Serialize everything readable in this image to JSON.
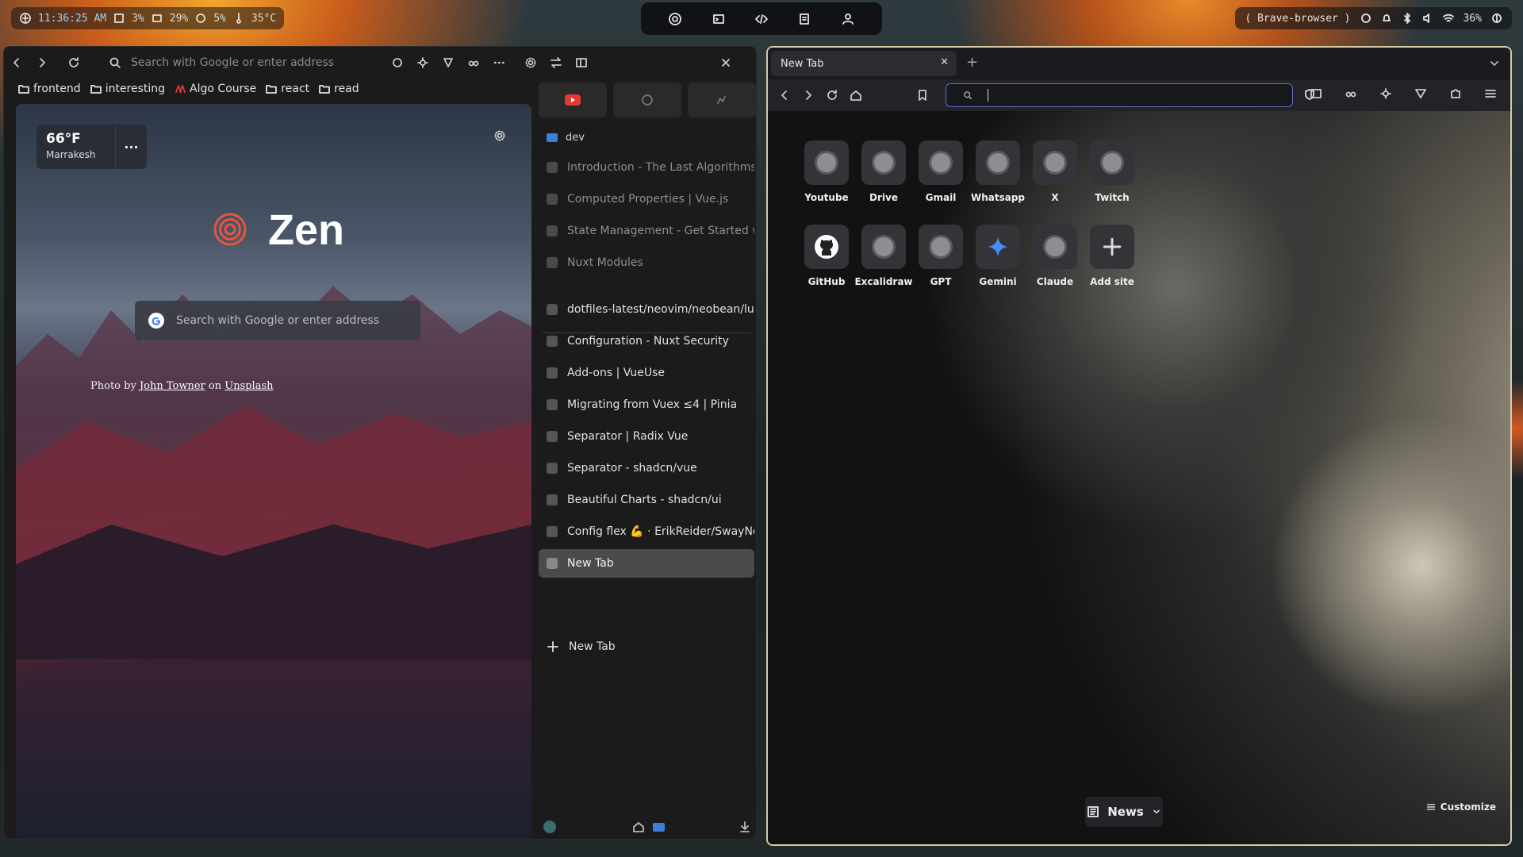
{
  "topbar": {
    "clock": "11:36:25 AM",
    "stats": [
      "3%",
      "29%",
      "5%",
      "35°C"
    ],
    "window_title": "( Brave-browser )",
    "battery": "36%"
  },
  "zen": {
    "address_placeholder": "Search with Google or enter address",
    "bookmarks": [
      "frontend",
      "interesting",
      "Algo Course",
      "react",
      "read"
    ],
    "weather": {
      "temp": "66°F",
      "city": "Marrakesh",
      "more": "···"
    },
    "brand": "Zen",
    "search_placeholder": "Search with Google or enter address",
    "credit": {
      "prefix": "Photo by",
      "author": "John Towner",
      "middle": "on",
      "site": "Unsplash"
    },
    "space_name": "dev",
    "pinned_tabs": [
      "Introduction - The Last Algorithms",
      "Computed Properties | Vue.js",
      "State Management - Get Started w",
      "Nuxt Modules"
    ],
    "tabs": [
      "dotfiles-latest/neovim/neobean/lua",
      "Configuration - Nuxt Security",
      "Add-ons | VueUse",
      "Migrating from Vuex ≤4 | Pinia",
      "Separator | Radix Vue",
      "Separator - shadcn/vue",
      "Beautiful Charts - shadcn/ui",
      "Config flex 💪 · ErikReider/SwayNot",
      "New Tab"
    ],
    "new_tab_label": "New Tab"
  },
  "brave": {
    "tab_title": "New Tab",
    "sites_row1": [
      "Youtube",
      "Drive",
      "Gmail",
      "Whatsapp",
      "X",
      "Twitch"
    ],
    "sites_row2": [
      "GitHub",
      "Excalidraw",
      "GPT",
      "Gemini",
      "Claude",
      "Add site"
    ],
    "news_label": "News",
    "customize_label": "Customize"
  },
  "colors": {
    "accent": "#6c6cc8",
    "zen_logo": "#e8553a",
    "youtube": "#e53935"
  }
}
